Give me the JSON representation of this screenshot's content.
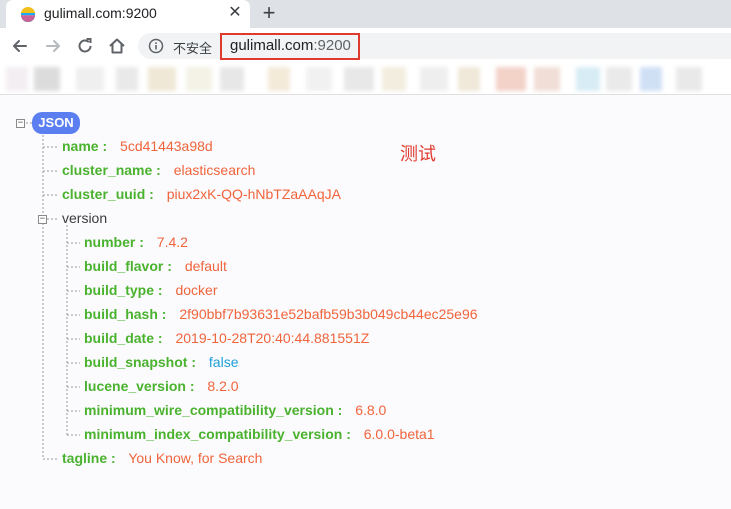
{
  "tab": {
    "title": "gulimall.com:9200",
    "close_glyph": "✕",
    "new_tab_glyph": "+"
  },
  "toolbar": {
    "security_label": "不安全",
    "url_host": "gulimall.com",
    "url_port": ":9200"
  },
  "icons": {
    "favicon": "elastic-favicon",
    "back": "arrow-left-icon",
    "forward": "arrow-right-icon",
    "reload": "reload-icon",
    "home": "home-icon",
    "info": "info-icon"
  },
  "viewer": {
    "root_label": "JSON",
    "root_toggle": "−",
    "annotation": "测试",
    "fields": {
      "name": {
        "key": "name",
        "value": "5cd41443a98d"
      },
      "cluster_name": {
        "key": "cluster_name",
        "value": "elasticsearch"
      },
      "cluster_uuid": {
        "key": "cluster_uuid",
        "value": "piux2xK-QQ-hNbTZaAAqJA"
      },
      "version_label": "version",
      "version_toggle": "−",
      "version": {
        "number": {
          "key": "number",
          "value": "7.4.2"
        },
        "build_flavor": {
          "key": "build_flavor",
          "value": "default"
        },
        "build_type": {
          "key": "build_type",
          "value": "docker"
        },
        "build_hash": {
          "key": "build_hash",
          "value": "2f90bbf7b93631e52bafb59b3b049cb44ec25e96"
        },
        "build_date": {
          "key": "build_date",
          "value": "2019-10-28T20:40:44.881551Z"
        },
        "build_snapshot": {
          "key": "build_snapshot",
          "value": "false"
        },
        "lucene_version": {
          "key": "lucene_version",
          "value": "8.2.0"
        },
        "minimum_wire_compatibility_version": {
          "key": "minimum_wire_compatibility_version",
          "value": "6.8.0"
        },
        "minimum_index_compatibility_version": {
          "key": "minimum_index_compatibility_version",
          "value": "6.0.0-beta1"
        }
      },
      "tagline": {
        "key": "tagline",
        "value": "You Know, for Search"
      }
    },
    "colon": ":"
  },
  "colors": {
    "key": "#4ab22e",
    "string_value": "#f0643c",
    "boolean_value": "#1e9fd7",
    "root_badge": "#5b7ff0",
    "url_highlight": "#e03a2f"
  }
}
